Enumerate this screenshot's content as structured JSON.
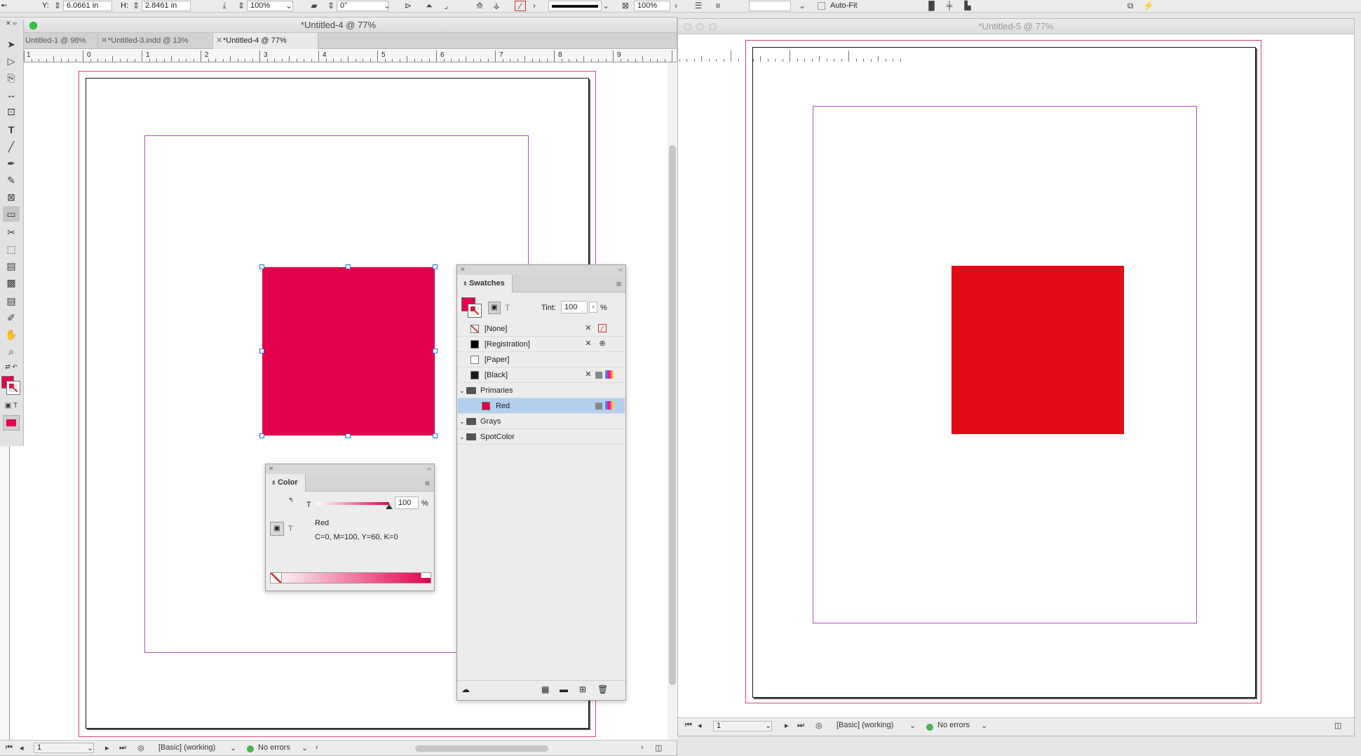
{
  "control_bar": {
    "y_label": "Y:",
    "y_value": "6.0661 in",
    "h_label": "H:",
    "h_value": "2.8461 in",
    "scale_x": "100%",
    "rotate": "0°",
    "stroke_scale": "100%",
    "autofit_label": "Auto-Fit"
  },
  "window_left": {
    "title": "*Untitled-4 @ 77%",
    "tabs": [
      {
        "label": "Untitled-1 @ 98%"
      },
      {
        "label": "*Untitled-3.indd @ 13%"
      },
      {
        "label": "*Untitled-4 @ 77%"
      }
    ],
    "ruler_numbers": [
      "1",
      "0",
      "1",
      "2",
      "3",
      "4",
      "5",
      "6",
      "7",
      "8",
      "9"
    ],
    "status": {
      "page": "1",
      "profile": "[Basic] (working)",
      "errors": "No errors"
    },
    "frame_color": "#e3004a"
  },
  "window_right": {
    "title": "*Untitled-5 @ 77%",
    "status": {
      "page": "1",
      "profile": "[Basic] (working)",
      "errors": "No errors"
    },
    "frame_color": "#e20a17"
  },
  "toolbar": {
    "tools": [
      "selection-tool",
      "direct-selection-tool",
      "page-tool",
      "gap-tool",
      "content-collector-tool",
      "type-tool",
      "line-tool",
      "pen-tool",
      "pencil-tool",
      "rectangle-frame-tool",
      "rectangle-tool",
      "scissors-tool",
      "free-transform-tool",
      "gradient-swatch-tool",
      "gradient-feather-tool",
      "note-tool",
      "eyedropper-tool",
      "hand-tool",
      "zoom-tool"
    ]
  },
  "swatches_panel": {
    "title": "Swatches",
    "tint_label": "Tint:",
    "tint_value": "100",
    "percent": "%",
    "swatches": [
      {
        "name": "[None]",
        "color": "none"
      },
      {
        "name": "[Registration]",
        "color": "#000000"
      },
      {
        "name": "[Paper]",
        "color": "#ffffff"
      },
      {
        "name": "[Black]",
        "color": "#1a1a1a"
      }
    ],
    "groups": [
      {
        "name": "Primaries"
      },
      {
        "name": "Grays"
      },
      {
        "name": "SpotColor"
      }
    ],
    "selected_swatch": {
      "name": "Red",
      "color": "#e3004a"
    }
  },
  "color_panel": {
    "title": "Color",
    "t_label": "T",
    "tint_value": "100",
    "percent": "%",
    "swatch_name": "Red",
    "values": "C=0, M=100, Y=60, K=0",
    "accent": "#e3004a",
    "tint_level": 1.0
  }
}
